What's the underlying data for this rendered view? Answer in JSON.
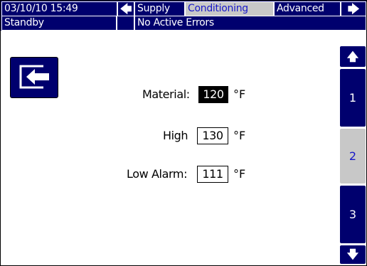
{
  "header": {
    "datetime": "03/10/10 15:49",
    "tabs": [
      "Supply",
      "Conditioning",
      "Advanced"
    ],
    "selected_tab": "Conditioning"
  },
  "status": {
    "mode": "Standby",
    "errors": "No Active Errors"
  },
  "fields": {
    "material_label": "Material:",
    "material_value": "120",
    "material_unit": "°F",
    "high_label": "High",
    "high_value": "130",
    "high_unit": "°F",
    "low_alarm_label": "Low Alarm:",
    "low_alarm_value": "111",
    "low_alarm_unit": "°F"
  },
  "pages": {
    "items": [
      "1",
      "2",
      "3"
    ],
    "selected": "2"
  },
  "icons": {
    "prev_tab": "arrow-left-icon",
    "next_tab": "arrow-right-icon",
    "page_up": "arrow-up-icon",
    "page_down": "arrow-down-icon",
    "exit": "exit-screen-icon"
  },
  "colors": {
    "bar_bg": "#00006e",
    "selected_bg": "#c8c8c8",
    "selected_text": "#1818c8",
    "active_field_bg": "#000000"
  }
}
